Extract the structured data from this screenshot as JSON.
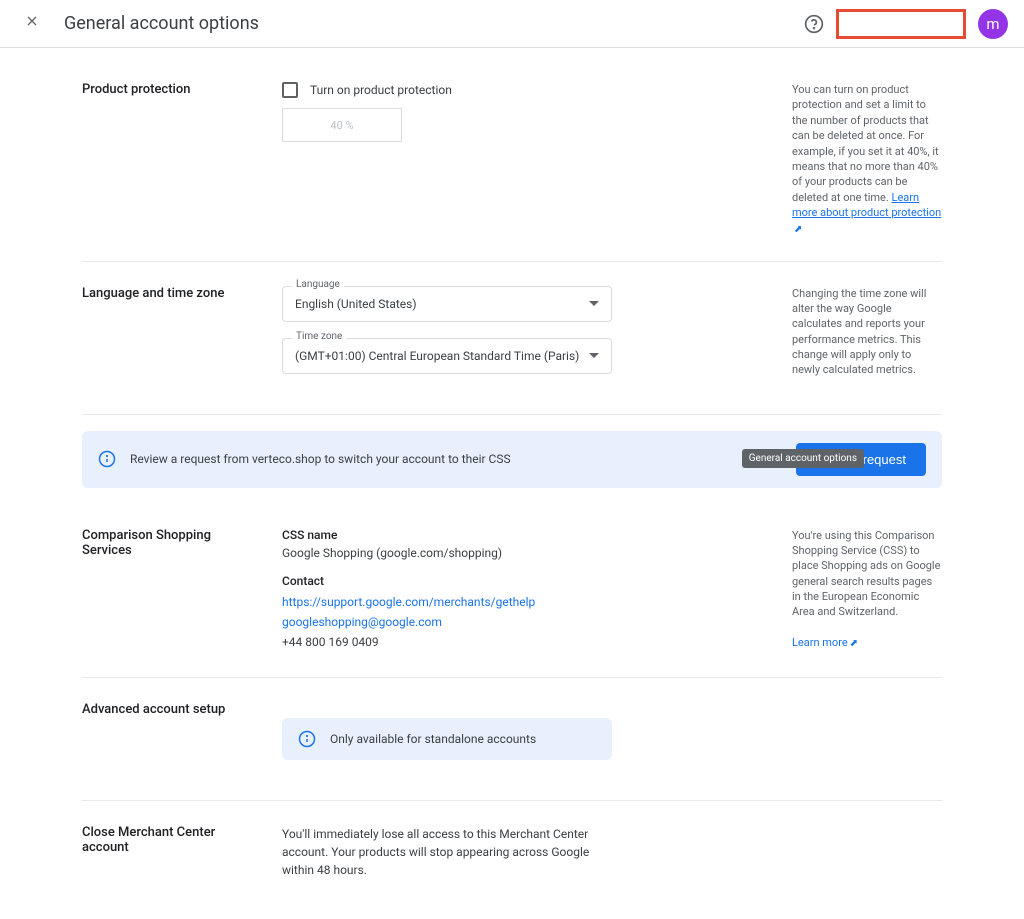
{
  "header": {
    "title": "General account options",
    "avatar_letter": "m"
  },
  "product_protection": {
    "label": "Product protection",
    "checkbox_label": "Turn on product protection",
    "percent_placeholder": "40 %",
    "side_text": "You can turn on product protection and set a limit to the number of products that can be deleted at once. For example, if you set it at 40%, it means that no more than 40% of your products can be deleted at one time.",
    "side_link": "Learn more about product protection"
  },
  "language_timezone": {
    "label": "Language and time zone",
    "language_field": "Language",
    "language_value": "English (United States)",
    "timezone_field": "Time zone",
    "timezone_value": "(GMT+01:00) Central European Standard Time (Paris)",
    "side_text": "Changing the time zone will alter the way Google calculates and reports your performance metrics. This change will apply only to newly calculated metrics."
  },
  "review_banner": {
    "text": "Review a request from verteco.shop to switch your account to their CSS",
    "button": "Review request"
  },
  "css_section": {
    "label": "Comparison Shopping Services",
    "name_label": "CSS name",
    "name_value": "Google Shopping (google.com/shopping)",
    "contact_label": "Contact",
    "contact_url": "https://support.google.com/merchants/gethelp",
    "contact_email": "googleshopping@google.com",
    "contact_phone": "+44 800 169 0409",
    "side_text": "You're using this Comparison Shopping Service (CSS) to place Shopping ads on Google general search results pages in the European Economic Area and Switzerland.",
    "side_link": "Learn more",
    "tooltip": "General account options"
  },
  "advanced": {
    "label": "Advanced account setup",
    "banner_text": "Only available for standalone accounts"
  },
  "close_account": {
    "label": "Close Merchant Center account",
    "text": "You'll immediately lose all access to this Merchant Center account. Your products will stop appearing across Google within 48 hours."
  }
}
